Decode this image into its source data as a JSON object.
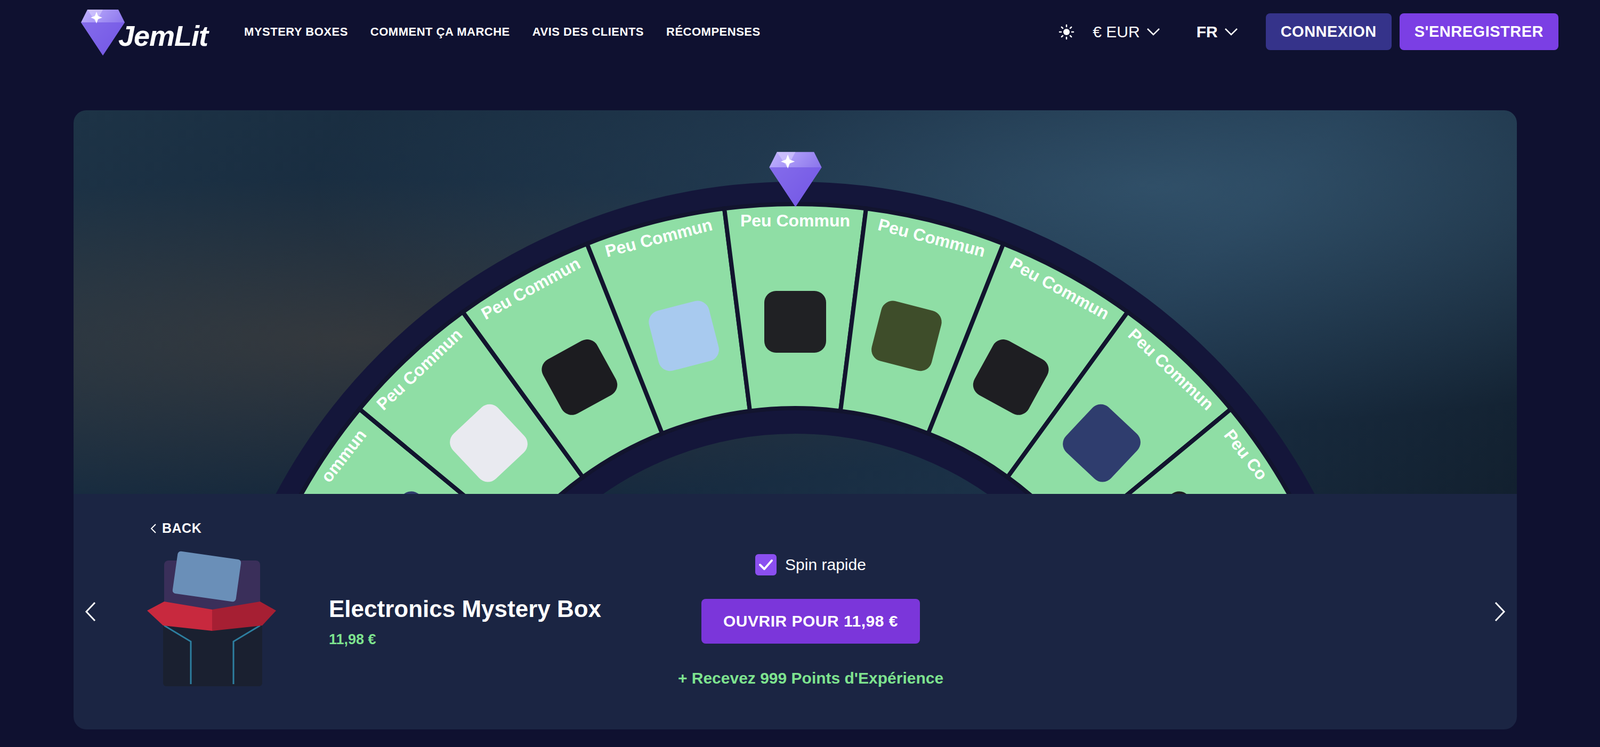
{
  "logo": {
    "text": "JemLit"
  },
  "nav": [
    "MYSTERY BOXES",
    "COMMENT ÇA MARCHE",
    "AVIS DES CLIENTS",
    "RÉCOMPENSES"
  ],
  "currency": "€ EUR",
  "language": "FR",
  "auth": {
    "login": "CONNEXION",
    "register": "S'ENREGISTRER"
  },
  "wheel": {
    "segments": [
      {
        "label": "ommun"
      },
      {
        "label": "Peu Commun"
      },
      {
        "label": "Peu Commun"
      },
      {
        "label": "Peu Commun"
      },
      {
        "label": "Peu Commun"
      },
      {
        "label": "Peu Commun"
      },
      {
        "label": "Peu Commun"
      },
      {
        "label": "Peu Commun"
      },
      {
        "label": "Peu Co"
      }
    ]
  },
  "back": "BACK",
  "box": {
    "title": "Electronics Mystery Box",
    "price": "11,98 €"
  },
  "fast_spin": {
    "label": "Spin rapide",
    "checked": true
  },
  "open_button": "OUVRIR POUR 11,98 €",
  "xp_reward": "+ Recevez 999 Points d'Expérience"
}
